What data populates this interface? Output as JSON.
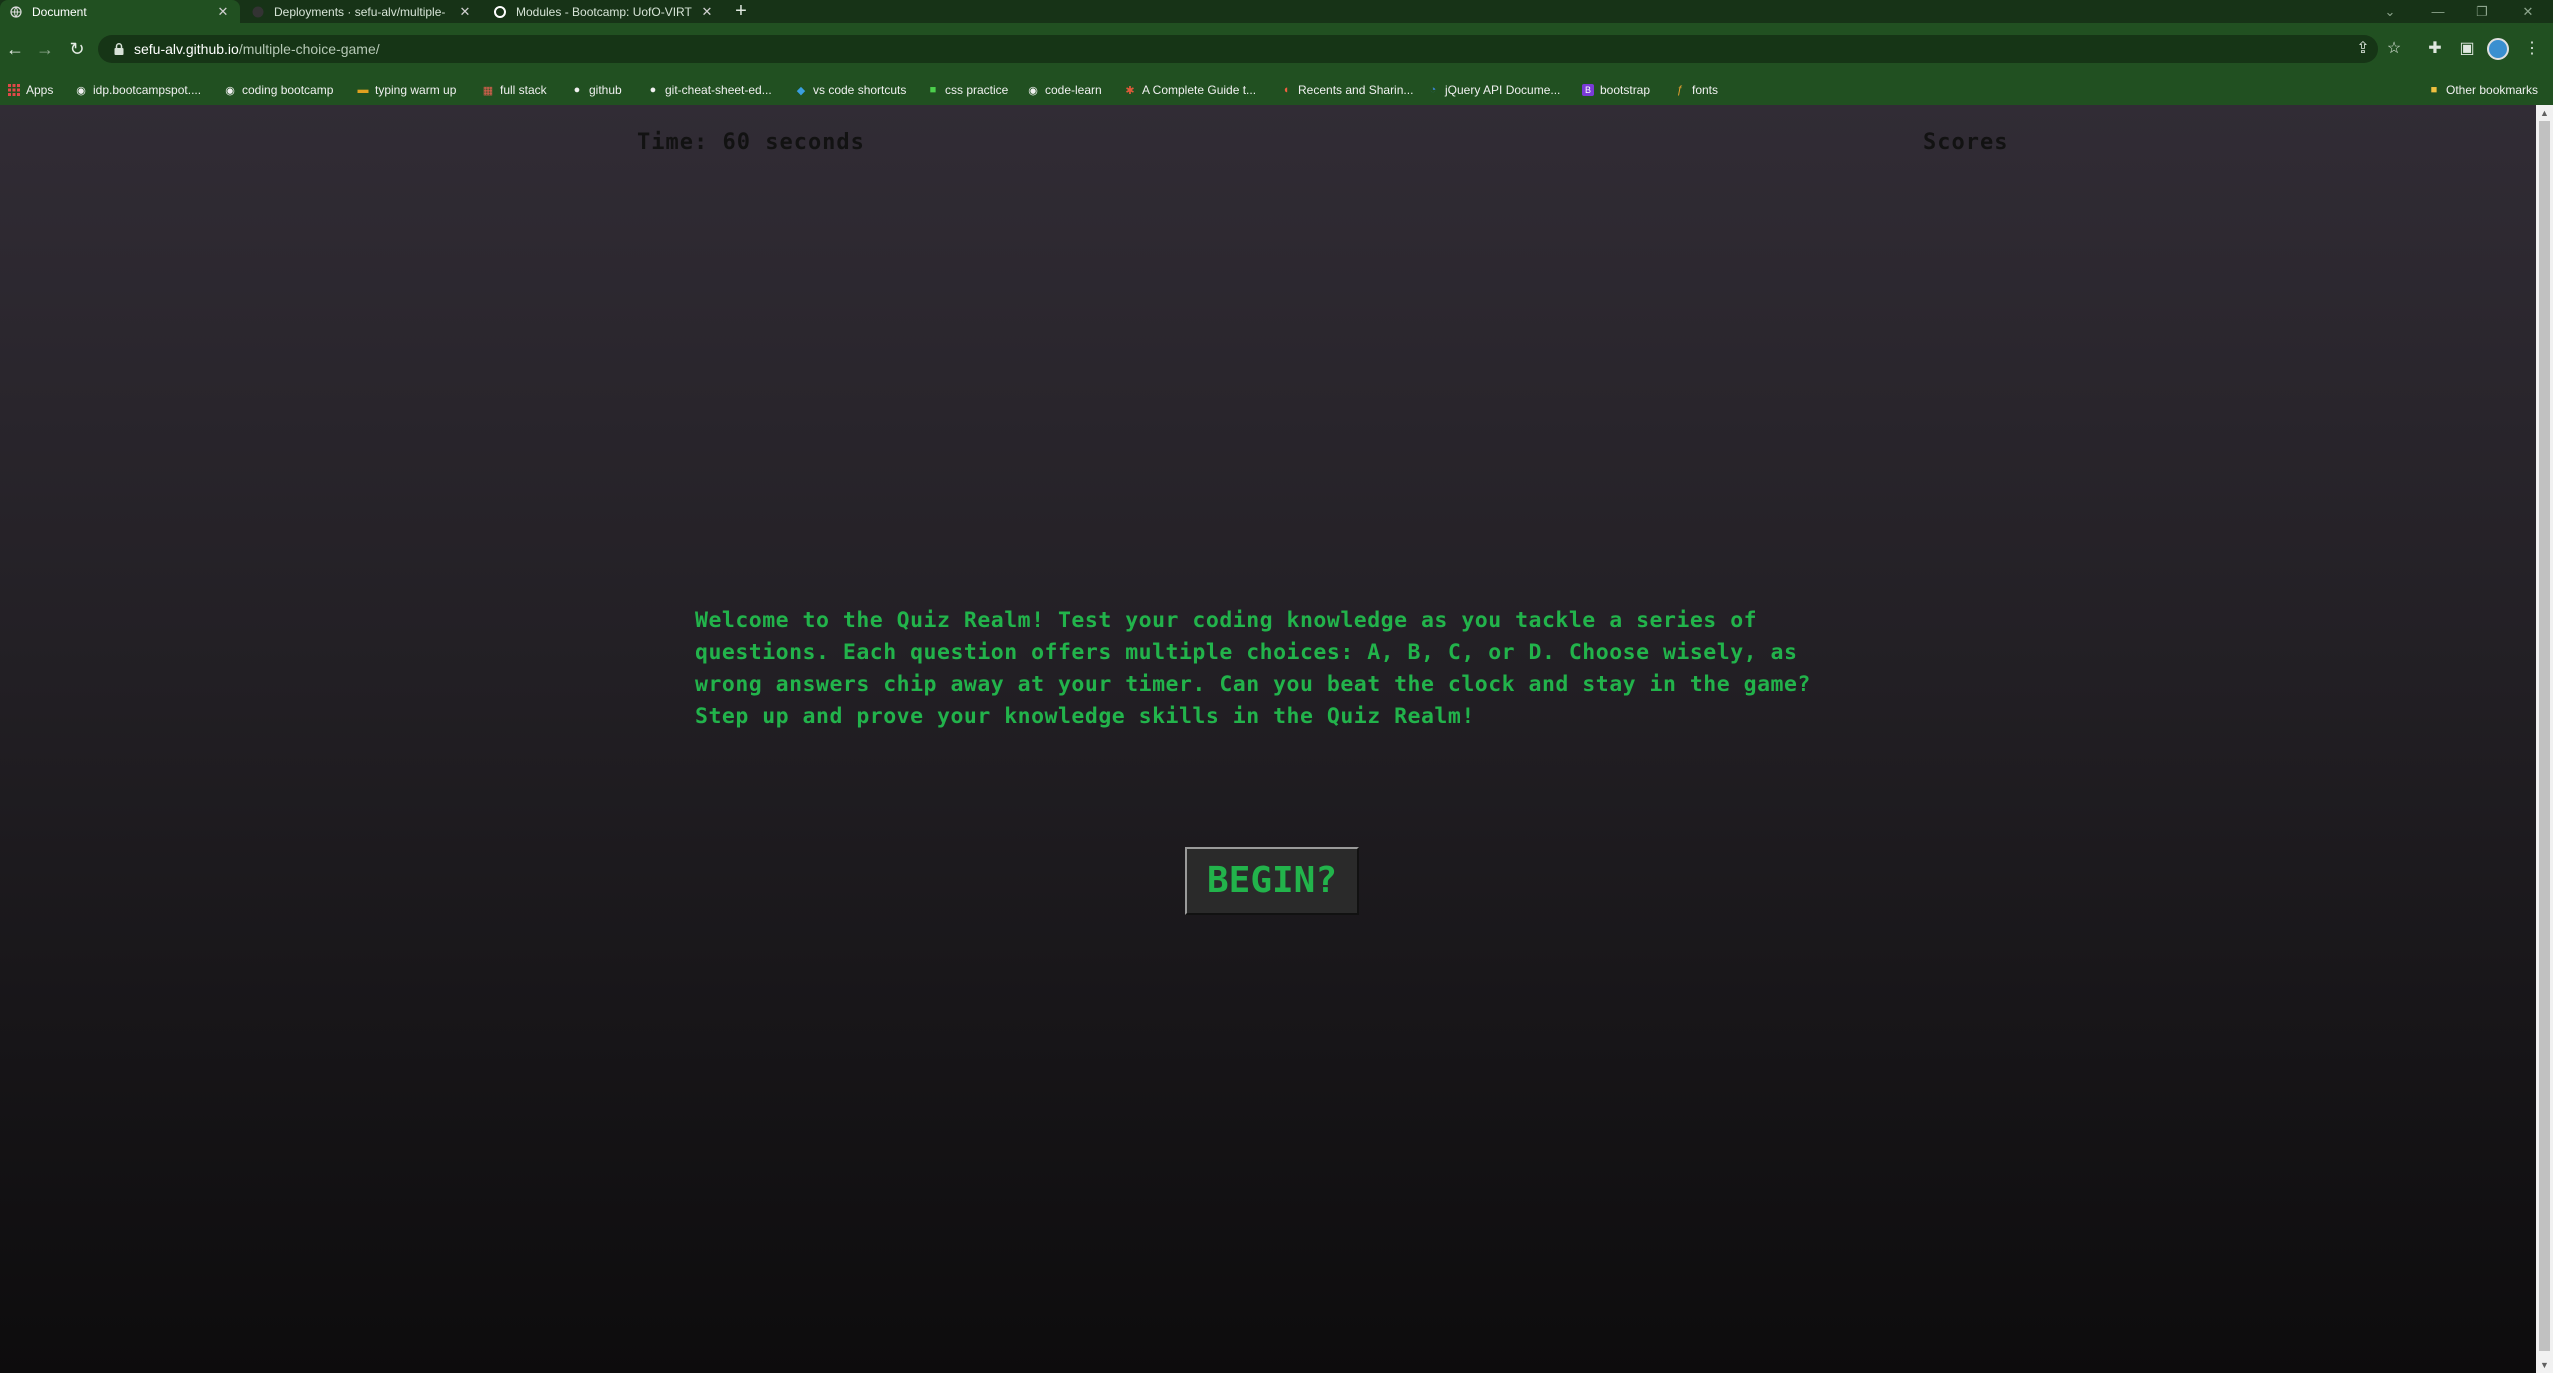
{
  "tabs": [
    {
      "title": "Document",
      "active": true
    },
    {
      "title": "Deployments · sefu-alv/multiple-",
      "active": false
    },
    {
      "title": "Modules - Bootcamp: UofO-VIRT",
      "active": false
    }
  ],
  "toolbar": {
    "url_host": "sefu-alv.github.io",
    "url_path": "/multiple-choice-game/"
  },
  "bookmarks": [
    {
      "label": "Apps",
      "icon": "apps-grid-icon"
    },
    {
      "label": "idp.bootcampspot....",
      "icon": "globe-icon"
    },
    {
      "label": "coding bootcamp",
      "icon": "globe-icon"
    },
    {
      "label": "typing warm up",
      "icon": "keyboard-icon"
    },
    {
      "label": "full stack",
      "icon": "grid-icon"
    },
    {
      "label": "github",
      "icon": "github-icon"
    },
    {
      "label": "git-cheat-sheet-ed...",
      "icon": "github-icon"
    },
    {
      "label": "vs code shortcuts",
      "icon": "vscode-icon"
    },
    {
      "label": "css practice",
      "icon": "frog-icon"
    },
    {
      "label": "code-learn",
      "icon": "globe-icon"
    },
    {
      "label": "A Complete Guide t...",
      "icon": "star-burst-icon"
    },
    {
      "label": "Recents and Sharin...",
      "icon": "figma-icon"
    },
    {
      "label": "jQuery API Docume...",
      "icon": "jquery-icon"
    },
    {
      "label": "bootstrap",
      "icon": "bootstrap-icon"
    },
    {
      "label": "fonts",
      "icon": "font-icon"
    }
  ],
  "other_bookmarks": "Other bookmarks",
  "page": {
    "timer_text": "Time: 60 seconds",
    "scores_label": "Scores",
    "intro_text": "Welcome to the Quiz Realm! Test your coding knowledge as you tackle a series of questions. Each question offers multiple choices: A, B, C, or D. Choose wisely, as wrong answers chip away at your timer. Can you beat the clock and stay in the game? Step up and prove your knowledge skills in the Quiz Realm!",
    "begin_label": "BEGIN?"
  },
  "colors": {
    "tab_strip": "#173317",
    "toolbar": "#215021",
    "accent_green": "#22b34b",
    "dark_text": "#121212"
  }
}
